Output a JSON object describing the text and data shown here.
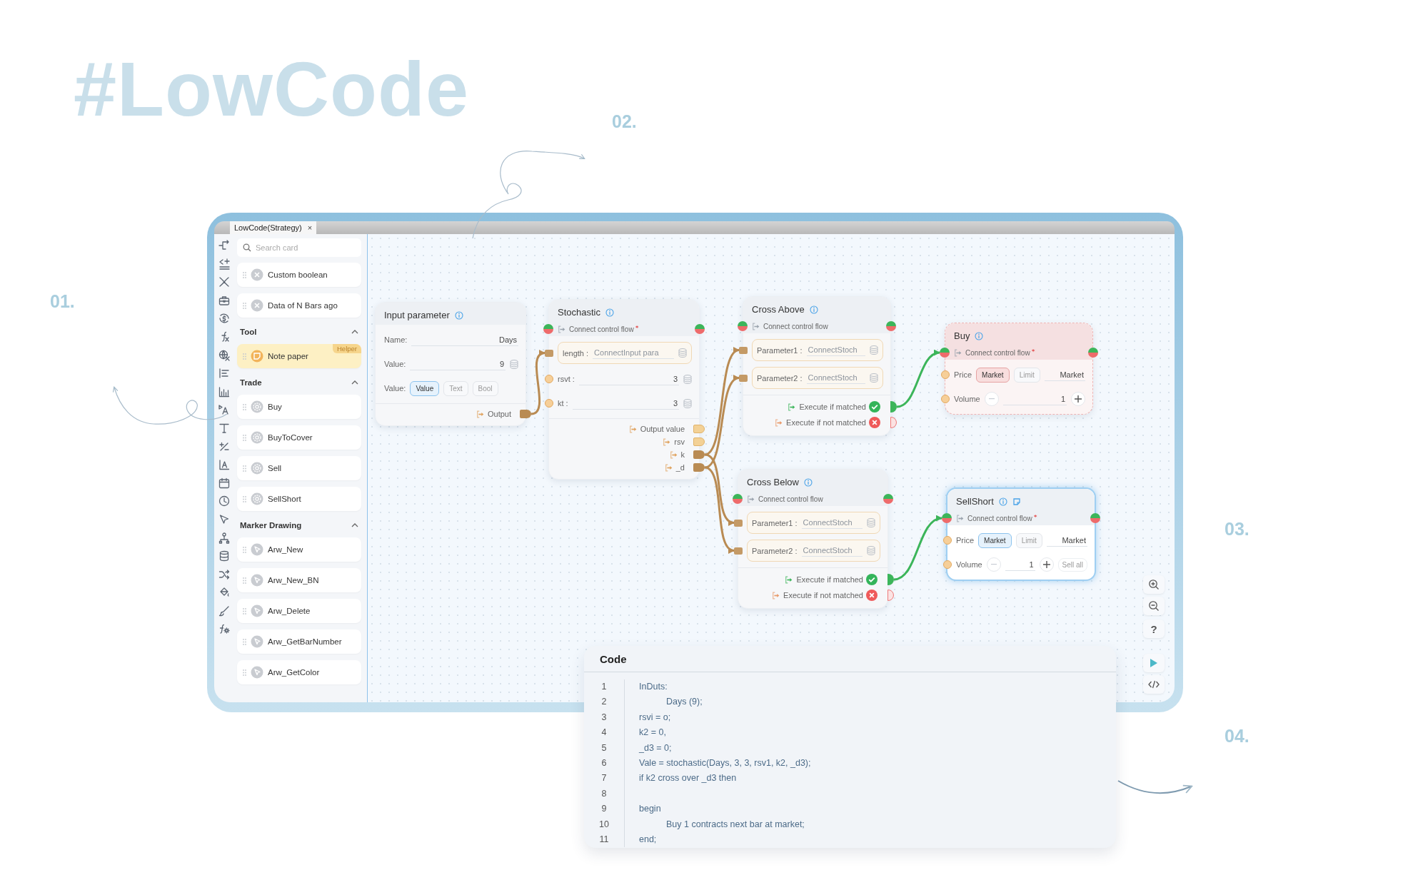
{
  "heading": "#LowCode",
  "callouts": [
    "01.",
    "02.",
    "03.",
    "04."
  ],
  "tab": {
    "label": "LowCode(Strategy)",
    "close": "×"
  },
  "search": {
    "placeholder": "Search card"
  },
  "palette": {
    "cards": [
      {
        "label": "Custom boolean",
        "kind": "condition"
      },
      {
        "label": "Data of N Bars ago",
        "kind": "condition"
      }
    ],
    "sections": [
      {
        "title": "Tool",
        "expanded": true,
        "cards": [
          {
            "label": "Note paper",
            "kind": "tool",
            "badge": "Helper"
          }
        ]
      },
      {
        "title": "Trade",
        "expanded": true,
        "cards": [
          {
            "label": "Buy",
            "kind": "trade"
          },
          {
            "label": "BuyToCover",
            "kind": "trade"
          },
          {
            "label": "Sell",
            "kind": "trade"
          },
          {
            "label": "SellShort",
            "kind": "trade"
          }
        ]
      },
      {
        "title": "Marker Drawing",
        "expanded": true,
        "cards": [
          {
            "label": "Arw_New",
            "kind": "marker"
          },
          {
            "label": "Arw_New_BN",
            "kind": "marker"
          },
          {
            "label": "Arw_Delete",
            "kind": "marker"
          },
          {
            "label": "Arw_GetBarNumber",
            "kind": "marker"
          },
          {
            "label": "Arw_GetColor",
            "kind": "marker"
          }
        ]
      }
    ]
  },
  "nodes": [
    {
      "title": "Input parameter",
      "selected": false,
      "invalid": false,
      "fields": [
        {
          "kind": "text",
          "label": "Name:",
          "value": "Days"
        },
        {
          "kind": "value",
          "label": "Value:",
          "value": "9"
        },
        {
          "kind": "choice",
          "label": "Value:",
          "options": [
            {
              "label": "Value",
              "selected": true
            },
            {
              "label": "Text",
              "selected": false
            },
            {
              "label": "Bool",
              "selected": false
            }
          ]
        }
      ],
      "outputs": [
        {
          "kind": "data",
          "label": "Output",
          "connected": true
        }
      ]
    },
    {
      "title": "Stochastic",
      "selected": false,
      "invalid": false,
      "flow": {
        "label": "Connect control flow",
        "required": true
      },
      "fields": [
        {
          "kind": "param",
          "label": "length :",
          "placeholder": "ConnectInput para",
          "connected": true
        },
        {
          "kind": "number",
          "label": "rsvt :",
          "value": "3",
          "connected": false
        },
        {
          "kind": "number",
          "label": "kt :",
          "value": "3",
          "connected": false
        }
      ],
      "outputs": [
        {
          "kind": "data",
          "label": "Output value",
          "connected": false
        },
        {
          "kind": "data",
          "label": "rsv",
          "connected": false
        },
        {
          "kind": "data",
          "label": "k",
          "connected": true
        },
        {
          "kind": "data",
          "label": "_d",
          "connected": true
        }
      ]
    },
    {
      "title": "Cross Above",
      "selected": false,
      "invalid": false,
      "flow": {
        "label": "Connect control flow",
        "required": false
      },
      "fields": [
        {
          "kind": "param",
          "label": "Parameter1 :",
          "placeholder": "ConnectStoch",
          "connected": true
        },
        {
          "kind": "param",
          "label": "Parameter2 :",
          "placeholder": "ConnectStoch",
          "connected": true
        }
      ],
      "outputs": [
        {
          "kind": "match",
          "label": "Execute if matched",
          "connected": true
        },
        {
          "kind": "nomatch",
          "label": "Execute if not matched",
          "connected": false
        }
      ]
    },
    {
      "title": "Cross Below",
      "selected": false,
      "invalid": false,
      "flow": {
        "label": "Connect control flow",
        "required": false
      },
      "fields": [
        {
          "kind": "param",
          "label": "Parameter1 :",
          "placeholder": "ConnectStoch",
          "connected": true
        },
        {
          "kind": "param",
          "label": "Parameter2 :",
          "placeholder": "ConnectStoch",
          "connected": true
        }
      ],
      "outputs": [
        {
          "kind": "match",
          "label": "Execute if matched",
          "connected": true
        },
        {
          "kind": "nomatch",
          "label": "Execute if not matched",
          "connected": false
        }
      ]
    },
    {
      "title": "Buy",
      "selected": false,
      "invalid": true,
      "flow": {
        "label": "Connect control flow",
        "required": true
      },
      "fields": [
        {
          "kind": "price",
          "label": "Price",
          "options": [
            {
              "label": "Market",
              "selected": true
            },
            {
              "label": "Limit",
              "selected": false
            }
          ],
          "value": "Market",
          "connected": false
        },
        {
          "kind": "volume",
          "label": "Volume",
          "value": "1",
          "connected": false
        }
      ]
    },
    {
      "title": "SellShort",
      "selected": true,
      "invalid": false,
      "note": true,
      "flow": {
        "label": "Connect control flow",
        "required": true
      },
      "fields": [
        {
          "kind": "price",
          "label": "Price",
          "options": [
            {
              "label": "Market",
              "selected": true
            },
            {
              "label": "Limit",
              "selected": false
            }
          ],
          "value": "Market",
          "connected": false
        },
        {
          "kind": "volume",
          "label": "Volume",
          "value": "1",
          "extra": "Sell all",
          "connected": false
        }
      ]
    }
  ],
  "canvas_tools": {
    "help": "?"
  },
  "code": {
    "title": "Code",
    "lines": [
      {
        "number": "1",
        "text": "InDuts:",
        "indented": false
      },
      {
        "number": "2",
        "text": "Days (9);",
        "indented": true
      },
      {
        "number": "3",
        "text": "rsvi = o;",
        "indented": false
      },
      {
        "number": "4",
        "text": "k2 = 0,",
        "indented": false
      },
      {
        "number": "5",
        "text": "_d3 = 0;",
        "indented": false
      },
      {
        "number": "6",
        "text": "Vale = stochastic(Days, 3, 3, rsv1, k2, _d3);",
        "indented": false
      },
      {
        "number": "7",
        "text": "if k2 cross over _d3 then",
        "indented": false
      },
      {
        "number": "8"
      },
      {
        "number": "9",
        "text": "begin",
        "indented": false
      },
      {
        "number": "10",
        "text": "Buy 1 contracts next bar at market;",
        "indented": true
      },
      {
        "number": "11",
        "text": "end;",
        "indented": false
      }
    ]
  }
}
